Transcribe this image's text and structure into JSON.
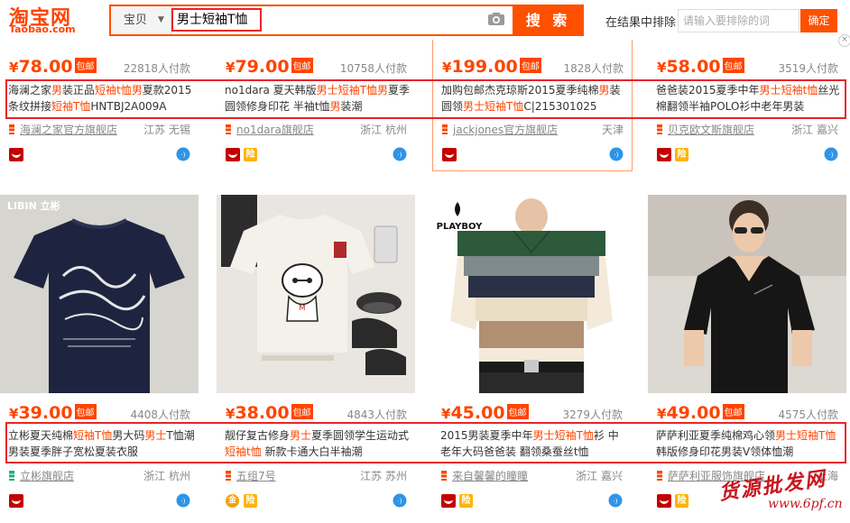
{
  "header": {
    "logo_cn": "淘宝网",
    "logo_en": "Taobao.com",
    "scope_label": "宝贝",
    "query": "男士短袖T恤",
    "search_btn": "搜 索",
    "exclude_label": "在结果中排除",
    "exclude_placeholder": "请输入要排除的词",
    "confirm_btn": "确定"
  },
  "colors": {
    "accent": "#ff4400",
    "highlight_border": "#e8242a"
  },
  "row1": [
    {
      "yen": "¥",
      "price": "78.00",
      "baoyou": "包邮",
      "sales": "22818人付款",
      "title": [
        {
          "t": "海澜之家"
        },
        {
          "t": "男",
          "h": 1
        },
        {
          "t": "装正品"
        },
        {
          "t": "短袖",
          "h": 1
        },
        {
          "t": "t恤",
          "h": 1
        },
        {
          "t": "男",
          "h": 1
        },
        {
          "t": "夏款2015条纹拼接"
        },
        {
          "t": "短袖",
          "h": 1
        },
        {
          "t": "T恤",
          "h": 1
        },
        {
          "t": "HNTBJ2A009A"
        }
      ],
      "shop": "海澜之家官方旗舰店",
      "location": "江苏 无锡",
      "badges": [
        "tmall"
      ]
    },
    {
      "yen": "¥",
      "price": "79.00",
      "baoyou": "包邮",
      "sales": "10758人付款",
      "title": [
        {
          "t": "no1dara 夏天韩版"
        },
        {
          "t": "男士",
          "h": 1
        },
        {
          "t": "短袖",
          "h": 1
        },
        {
          "t": "T恤",
          "h": 1
        },
        {
          "t": "男",
          "h": 1
        },
        {
          "t": "夏季圆领修身印花 半袖t恤"
        },
        {
          "t": "男",
          "h": 1
        },
        {
          "t": "装潮"
        }
      ],
      "shop": "no1dara旗舰店",
      "location": "浙江 杭州",
      "badges": [
        "tmall",
        "xian"
      ]
    },
    {
      "yen": "¥",
      "price": "199.00",
      "baoyou": "包邮",
      "sales": "1828人付款",
      "title": [
        {
          "t": "加购包邮杰克琼斯2015夏季纯棉"
        },
        {
          "t": "男",
          "h": 1
        },
        {
          "t": "装圆领"
        },
        {
          "t": "男士",
          "h": 1
        },
        {
          "t": "短袖",
          "h": 1
        },
        {
          "t": "T恤",
          "h": 1
        },
        {
          "t": "C|215301025"
        }
      ],
      "shop": "jackjones官方旗舰店",
      "location": "天津",
      "badges": [
        "tmall"
      ]
    },
    {
      "yen": "¥",
      "price": "58.00",
      "baoyou": "包邮",
      "sales": "3519人付款",
      "title": [
        {
          "t": "爸爸装2015夏季中年"
        },
        {
          "t": "男士",
          "h": 1
        },
        {
          "t": "短袖",
          "h": 1
        },
        {
          "t": "t恤",
          "h": 1
        },
        {
          "t": "丝光棉翻领半袖POLO衫中老年男装"
        }
      ],
      "shop": "贝克欧文斯旗舰店",
      "location": "浙江 嘉兴",
      "badges": [
        "tmall",
        "xian"
      ]
    }
  ],
  "row2": [
    {
      "yen": "¥",
      "price": "39.00",
      "baoyou": "包邮",
      "sales": "4408人付款",
      "title": [
        {
          "t": "立彬夏天纯棉"
        },
        {
          "t": "短袖",
          "h": 1
        },
        {
          "t": "T恤",
          "h": 1
        },
        {
          "t": "男大码"
        },
        {
          "t": "男士",
          "h": 1
        },
        {
          "t": "T恤潮男装夏季胖子宽松夏装衣服"
        }
      ],
      "shop": "立彬旗舰店",
      "location": "浙江 杭州",
      "badges": [
        "tmall",
        "ww"
      ]
    },
    {
      "yen": "¥",
      "price": "38.00",
      "baoyou": "包邮",
      "sales": "4843人付款",
      "title": [
        {
          "t": "靓仔复古修身"
        },
        {
          "t": "男士",
          "h": 1
        },
        {
          "t": "夏季圆领学生运动式"
        },
        {
          "t": "短袖",
          "h": 1
        },
        {
          "t": "t恤",
          "h": 1
        },
        {
          "t": " 新款卡通大白半袖潮"
        }
      ],
      "shop": "五组7号",
      "location": "江苏 苏州",
      "badges": [
        "jin",
        "xian"
      ]
    },
    {
      "yen": "¥",
      "price": "45.00",
      "baoyou": "包邮",
      "sales": "3279人付款",
      "title": [
        {
          "t": "2015男装夏季中年"
        },
        {
          "t": "男士",
          "h": 1
        },
        {
          "t": "短袖",
          "h": 1
        },
        {
          "t": "T恤",
          "h": 1
        },
        {
          "t": "衫 中老年大码爸爸装 翻领桑蚕丝t恤"
        }
      ],
      "shop": "来自馨馨的瞳瞳",
      "location": "浙江 嘉兴",
      "badges": [
        "tmall",
        "xian"
      ]
    },
    {
      "yen": "¥",
      "price": "49.00",
      "baoyou": "包邮",
      "sales": "4575人付款",
      "title": [
        {
          "t": "萨萨利亚夏季纯棉鸡心领"
        },
        {
          "t": "男士",
          "h": 1
        },
        {
          "t": "短袖",
          "h": 1
        },
        {
          "t": "T恤",
          "h": 1
        },
        {
          "t": "韩版修身印花男装V领体恤潮"
        }
      ],
      "shop": "萨萨利亚服饰旗舰店",
      "location": "上海",
      "badges": [
        "tmall",
        "xian"
      ]
    }
  ],
  "watermark": {
    "text": "货源批发网",
    "url": "www.6pf.cn"
  }
}
